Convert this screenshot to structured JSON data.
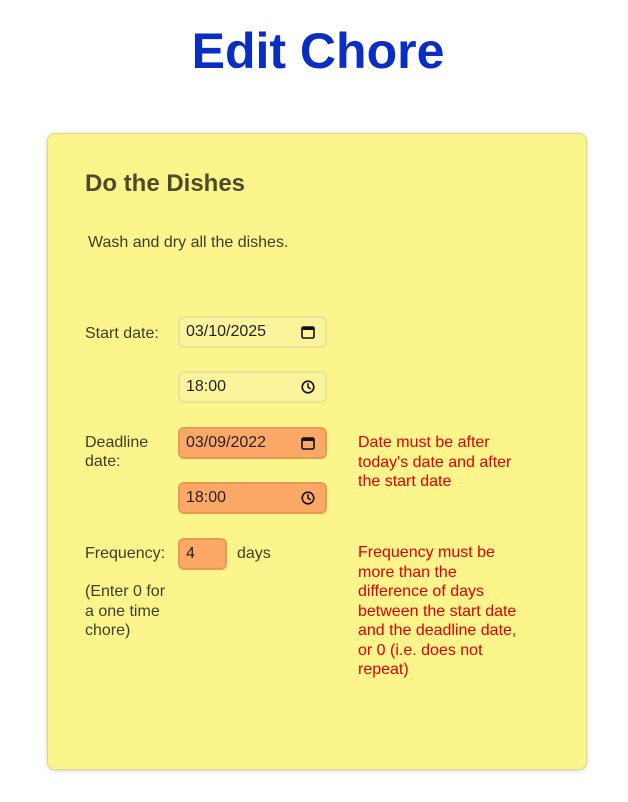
{
  "page": {
    "title": "Edit Chore"
  },
  "chore": {
    "name": "Do the Dishes",
    "description": "Wash and dry all the dishes."
  },
  "start": {
    "label": "Start date:",
    "date_value": "03/10/2025",
    "time_value": "18:00"
  },
  "deadline": {
    "label_line1": "Deadline",
    "label_line2": "date:",
    "date_value": "03/09/2022",
    "time_value": "18:00",
    "error": {
      "line1": "Date must be after",
      "line2": "today's date and after",
      "line3": "the start date"
    }
  },
  "frequency": {
    "label": "Frequency:",
    "value": "4",
    "unit": "days",
    "hint": {
      "line1": "(Enter 0 for",
      "line2": "a one time",
      "line3": "chore)"
    },
    "error": {
      "line1": "Frequency must be",
      "line2": "more than the",
      "line3": "difference of days",
      "line4": "between the start date",
      "line5": "and the deadline date,",
      "line6": "or 0 (i.e. does not",
      "line7": "repeat)"
    }
  },
  "colors": {
    "title": "#0a2ec4",
    "card_bg": "#fbf58c",
    "error_field_bg": "#fea868",
    "error_text": "#e00000"
  },
  "icons": {
    "date": "calendar-icon",
    "time": "clock-icon"
  }
}
